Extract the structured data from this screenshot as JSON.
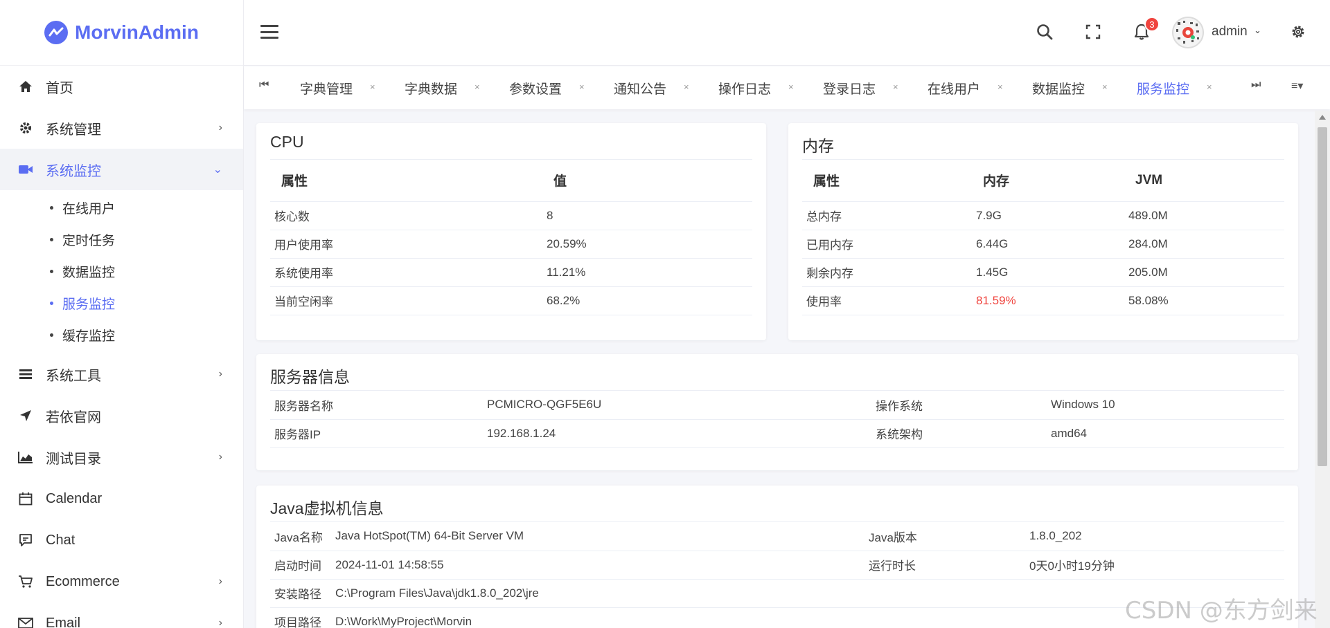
{
  "app": {
    "name": "MorvinAdmin"
  },
  "sidebar": {
    "items": [
      {
        "label": "首页"
      },
      {
        "label": "系统管理"
      },
      {
        "label": "系统监控"
      },
      {
        "label": "系统工具"
      },
      {
        "label": "若依官网"
      },
      {
        "label": "测试目录"
      },
      {
        "label": "Calendar"
      },
      {
        "label": "Chat"
      },
      {
        "label": "Ecommerce"
      },
      {
        "label": "Email"
      }
    ],
    "monitor_children": [
      "在线用户",
      "定时任务",
      "数据监控",
      "服务监控",
      "缓存监控"
    ]
  },
  "header": {
    "notification_count": "3",
    "user": "admin"
  },
  "tabs": [
    "字典管理",
    "字典数据",
    "参数设置",
    "通知公告",
    "操作日志",
    "登录日志",
    "在线用户",
    "数据监控",
    "服务监控"
  ],
  "cpu": {
    "title": "CPU",
    "headers": [
      "属性",
      "值"
    ],
    "rows": [
      [
        "核心数",
        "8"
      ],
      [
        "用户使用率",
        "20.59%"
      ],
      [
        "系统使用率",
        "11.21%"
      ],
      [
        "当前空闲率",
        "68.2%"
      ]
    ]
  },
  "memory": {
    "title": "内存",
    "headers": [
      "属性",
      "内存",
      "JVM"
    ],
    "rows": [
      [
        "总内存",
        "7.9G",
        "489.0M"
      ],
      [
        "已用内存",
        "6.44G",
        "284.0M"
      ],
      [
        "剩余内存",
        "1.45G",
        "205.0M"
      ],
      [
        "使用率",
        "81.59%",
        "58.08%"
      ]
    ]
  },
  "server": {
    "title": "服务器信息",
    "rows": [
      [
        "服务器名称",
        "PCMICRO-QGF5E6U",
        "操作系统",
        "Windows 10"
      ],
      [
        "服务器IP",
        "192.168.1.24",
        "系统架构",
        "amd64"
      ]
    ]
  },
  "jvm": {
    "title": "Java虚拟机信息",
    "rows": [
      [
        "Java名称",
        "Java HotSpot(TM) 64-Bit Server VM",
        "Java版本",
        "1.8.0_202"
      ],
      [
        "启动时间",
        "2024-11-01 14:58:55",
        "运行时长",
        "0天0小时19分钟"
      ],
      [
        "安装路径",
        "C:\\Program Files\\Java\\jdk1.8.0_202\\jre",
        "",
        ""
      ],
      [
        "项目路径",
        "D:\\Work\\MyProject\\Morvin",
        "",
        ""
      ]
    ]
  },
  "watermark": "CSDN @东方剑来",
  "colors": {
    "accent": "#5b6df2",
    "danger": "#f0443e"
  }
}
